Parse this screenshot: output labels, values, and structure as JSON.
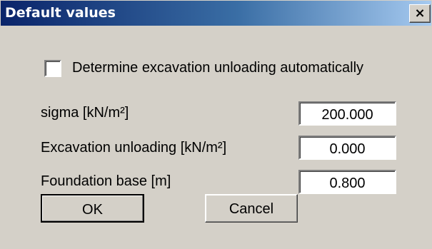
{
  "dialog": {
    "title": "Default values",
    "close_label": "×"
  },
  "checkbox": {
    "label": "Determine excavation unloading automatically",
    "checked": false
  },
  "fields": [
    {
      "label": "sigma [kN/m²]",
      "value": "200.000"
    },
    {
      "label": "Excavation unloading [kN/m²]",
      "value": "0.000"
    },
    {
      "label": "Foundation base [m]",
      "value": "0.800"
    }
  ],
  "buttons": {
    "ok": "OK",
    "cancel": "Cancel"
  },
  "colors": {
    "face": "#d4d0c8",
    "titlebar_start": "#0a246a",
    "titlebar_end": "#a6caf0"
  }
}
